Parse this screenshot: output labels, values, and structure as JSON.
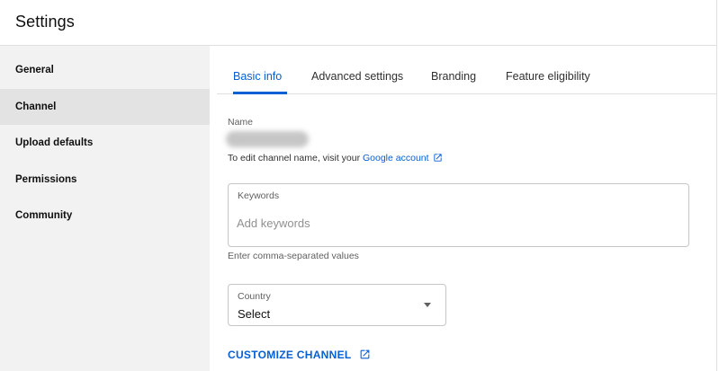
{
  "header": {
    "title": "Settings"
  },
  "sidebar": {
    "items": [
      {
        "label": "General"
      },
      {
        "label": "Channel"
      },
      {
        "label": "Upload defaults"
      },
      {
        "label": "Permissions"
      },
      {
        "label": "Community"
      }
    ],
    "active": "Channel"
  },
  "tabs": {
    "items": [
      {
        "label": "Basic info"
      },
      {
        "label": "Advanced settings"
      },
      {
        "label": "Branding"
      },
      {
        "label": "Feature eligibility"
      }
    ],
    "active": "Basic info"
  },
  "basic_info": {
    "name_label": "Name",
    "edit_hint_prefix": "To edit channel name, visit your ",
    "edit_hint_link": "Google account",
    "keywords_label": "Keywords",
    "keywords_value": "",
    "keywords_placeholder": "Add keywords",
    "keywords_helper": "Enter comma-separated values",
    "country_label": "Country",
    "country_value": "Select",
    "customize_label": "CUSTOMIZE CHANNEL"
  },
  "icons": {
    "external_link": "open-in-new-icon",
    "dropdown": "dropdown-caret-icon"
  },
  "colors": {
    "accent": "#065fd4",
    "sidebar_bg": "#f2f2f2",
    "sidebar_active_bg": "#e3e3e3",
    "border": "#c6c6c6",
    "divider": "#e0e0e0"
  }
}
